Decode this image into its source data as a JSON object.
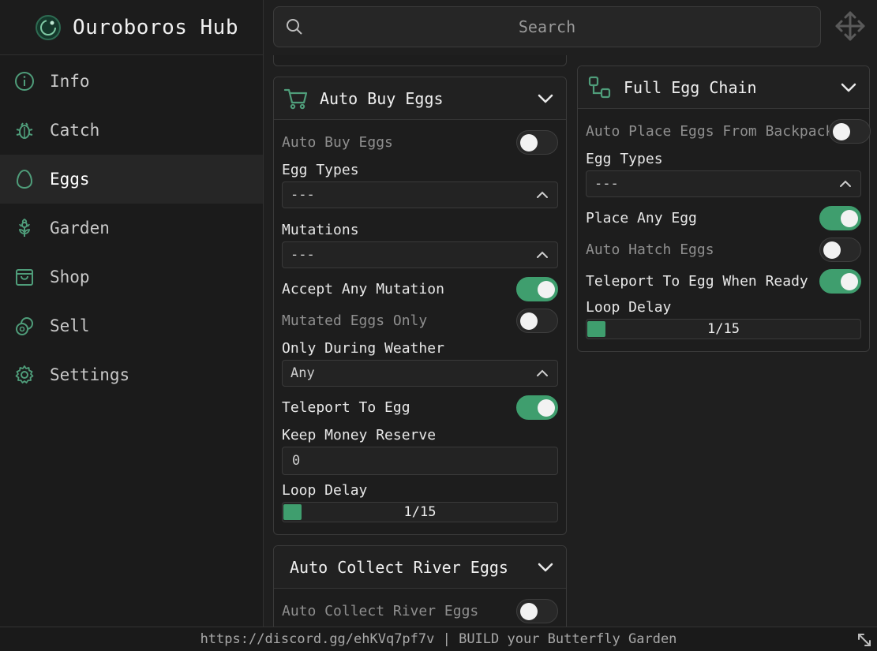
{
  "app": {
    "title": "Ouroboros Hub"
  },
  "search": {
    "placeholder": "Search"
  },
  "sidebar": {
    "items": [
      {
        "label": "Info",
        "icon": "info-icon",
        "active": false
      },
      {
        "label": "Catch",
        "icon": "bug-icon",
        "active": false
      },
      {
        "label": "Eggs",
        "icon": "egg-icon",
        "active": true
      },
      {
        "label": "Garden",
        "icon": "flower-icon",
        "active": false
      },
      {
        "label": "Shop",
        "icon": "shopping-bag-icon",
        "active": false
      },
      {
        "label": "Sell",
        "icon": "coins-icon",
        "active": false
      },
      {
        "label": "Settings",
        "icon": "gear-icon",
        "active": false
      }
    ]
  },
  "auto_buy": {
    "title": "Auto Buy Eggs",
    "auto_buy_label": "Auto Buy Eggs",
    "auto_buy_on": false,
    "egg_types_label": "Egg Types",
    "egg_types_value": "---",
    "mutations_label": "Mutations",
    "mutations_value": "---",
    "accept_any_label": "Accept Any Mutation",
    "accept_any_on": true,
    "mutated_only_label": "Mutated Eggs Only",
    "mutated_only_on": false,
    "weather_label": "Only During Weather",
    "weather_value": "Any",
    "teleport_label": "Teleport To Egg",
    "teleport_on": true,
    "reserve_label": "Keep Money Reserve",
    "reserve_value": "0",
    "loop_delay_label": "Loop Delay",
    "loop_delay_value": "1/15",
    "loop_delay_fraction": 0.0667
  },
  "river": {
    "title": "Auto Collect River Eggs",
    "collect_label": "Auto Collect River Eggs",
    "collect_on": false
  },
  "chain": {
    "title": "Full Egg Chain",
    "auto_place_label": "Auto Place Eggs From Backpack",
    "auto_place_on": false,
    "egg_types_label": "Egg Types",
    "egg_types_value": "---",
    "place_any_label": "Place Any Egg",
    "place_any_on": true,
    "auto_hatch_label": "Auto Hatch Eggs",
    "auto_hatch_on": false,
    "teleport_ready_label": "Teleport To Egg When Ready",
    "teleport_ready_on": true,
    "loop_delay_label": "Loop Delay",
    "loop_delay_value": "1/15",
    "loop_delay_fraction": 0.0667
  },
  "footer": {
    "text": "https://discord.gg/ehKVq7pf7v | BUILD your Butterfly Garden"
  },
  "colors": {
    "accent": "#3f9e6e",
    "background": "#1f1f1f"
  }
}
